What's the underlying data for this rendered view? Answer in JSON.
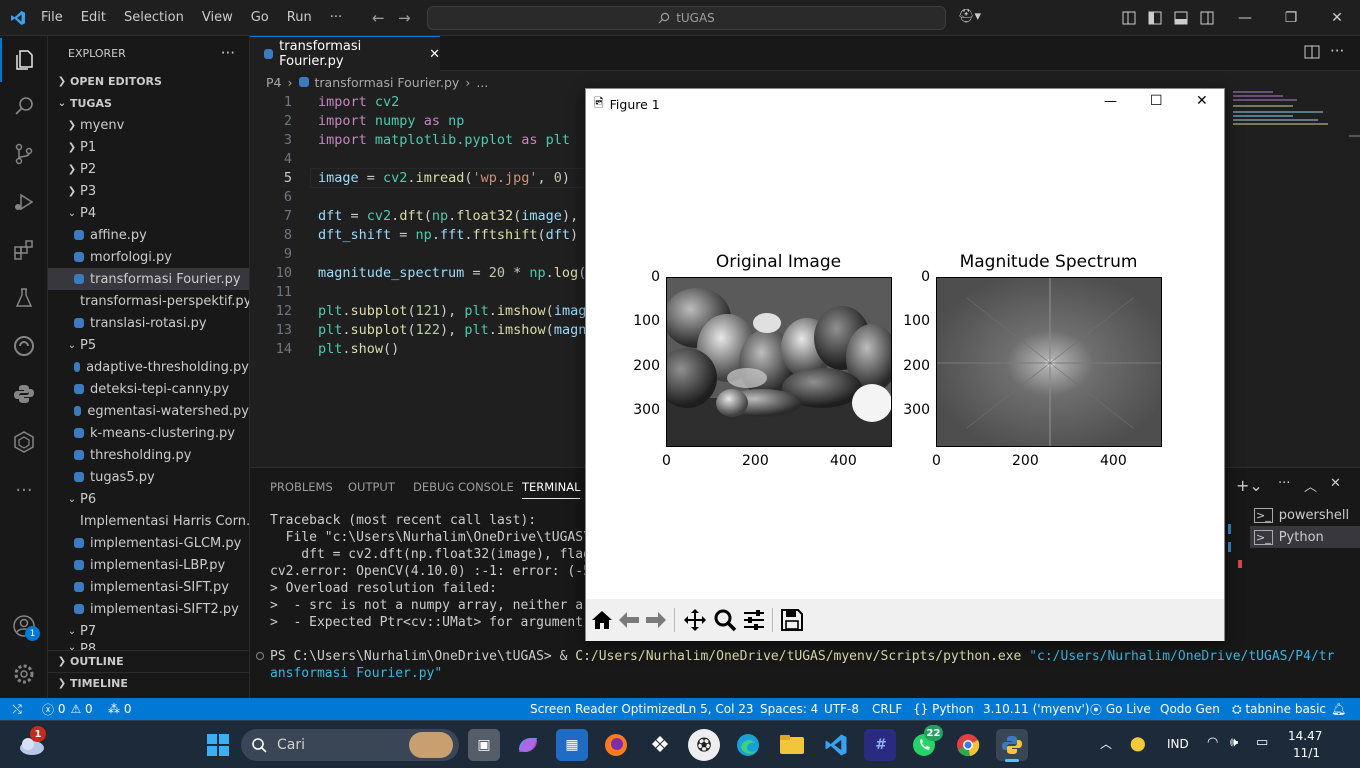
{
  "titlebar": {
    "menu": [
      "File",
      "Edit",
      "Selection",
      "View",
      "Go",
      "Run",
      "···"
    ],
    "search_text": "tUGAS"
  },
  "explorer": {
    "header": "EXPLORER",
    "open_editors": "OPEN EDITORS",
    "root": "TUGAS",
    "folders_top": [
      "myenv",
      "P1",
      "P2",
      "P3"
    ],
    "p4": {
      "name": "P4",
      "files": [
        "affine.py",
        "morfologi.py",
        "transformasi Fourier.py",
        "transformasi-perspektif.py",
        "translasi-rotasi.py"
      ]
    },
    "p5": {
      "name": "P5",
      "files": [
        "adaptive-thresholding.py",
        "deteksi-tepi-canny.py",
        "egmentasi-watershed.py",
        "k-means-clustering.py",
        "thresholding.py",
        "tugas5.py"
      ]
    },
    "p6": {
      "name": "P6",
      "files": [
        "Implementasi Harris Corn...",
        "implementasi-GLCM.py",
        "implementasi-LBP.py",
        "implementasi-SIFT.py",
        "implementasi-SIFT2.py"
      ]
    },
    "p7": "P7",
    "p8": "P8",
    "outline": "OUTLINE",
    "timeline": "TIMELINE"
  },
  "editor": {
    "tab": "transformasi Fourier.py",
    "breadcrumb": [
      "P4",
      "transformasi Fourier.py",
      "..."
    ],
    "line_numbers": [
      "1",
      "2",
      "3",
      "4",
      "5",
      "6",
      "7",
      "8",
      "9",
      "10",
      "11",
      "12",
      "13",
      "14"
    ]
  },
  "panel": {
    "tabs": [
      "PROBLEMS",
      "OUTPUT",
      "DEBUG CONSOLE",
      "TERMINAL"
    ],
    "terminal_lines": [
      "Traceback (most recent call last):",
      "  File \"c:\\Users\\Nurhalim\\OneDrive\\tUGAS\\P4\\t",
      "    dft = cv2.dft(np.float32(image), flags=cv",
      "cv2.error: OpenCV(4.10.0) :-1: error: (-5:Bad",
      "> Overload resolution failed:",
      ">  - src is not a numpy array, neither a scal",
      ">  - Expected Ptr<cv::UMat> for argument 'src"
    ],
    "prompt": "PS C:\\Users\\Nurhalim\\OneDrive\\tUGAS> & ",
    "command_exe": "C:/Users/Nurhalim/OneDrive/tUGAS/myenv/Scripts/python.exe",
    "command_arg1": "\"c:/Users/Nurhalim/OneDrive/tUGAS/P4/tr",
    "command_arg2": "ansformasi Fourier.py\"",
    "terminals": [
      "powershell",
      "Python"
    ]
  },
  "statusbar": {
    "errors": "0",
    "warnings": "0",
    "ports": "0",
    "items": [
      "Screen Reader Optimized",
      "Ln 5, Col 23",
      "Spaces: 4",
      "UTF-8",
      "CRLF",
      "{} Python",
      "3.10.11 ('myenv')",
      "Go Live",
      "Qodo Gen",
      "tabnine basic"
    ]
  },
  "figure": {
    "title": "Figure 1",
    "left_title": "Original Image",
    "right_title": "Magnitude Spectrum",
    "yticks": [
      "0",
      "100",
      "200",
      "300"
    ],
    "xticks": [
      "0",
      "200",
      "400"
    ]
  },
  "taskbar": {
    "search": "Cari",
    "lang": "IND",
    "time": "14.47",
    "date": "11/1",
    "badge_weather": "1",
    "badge_whatsapp": "22",
    "badge_accounts": "1"
  },
  "colors": {
    "accent": "#0078d4",
    "editor_bg": "#1f1f1f",
    "sidebar_bg": "#181818"
  }
}
